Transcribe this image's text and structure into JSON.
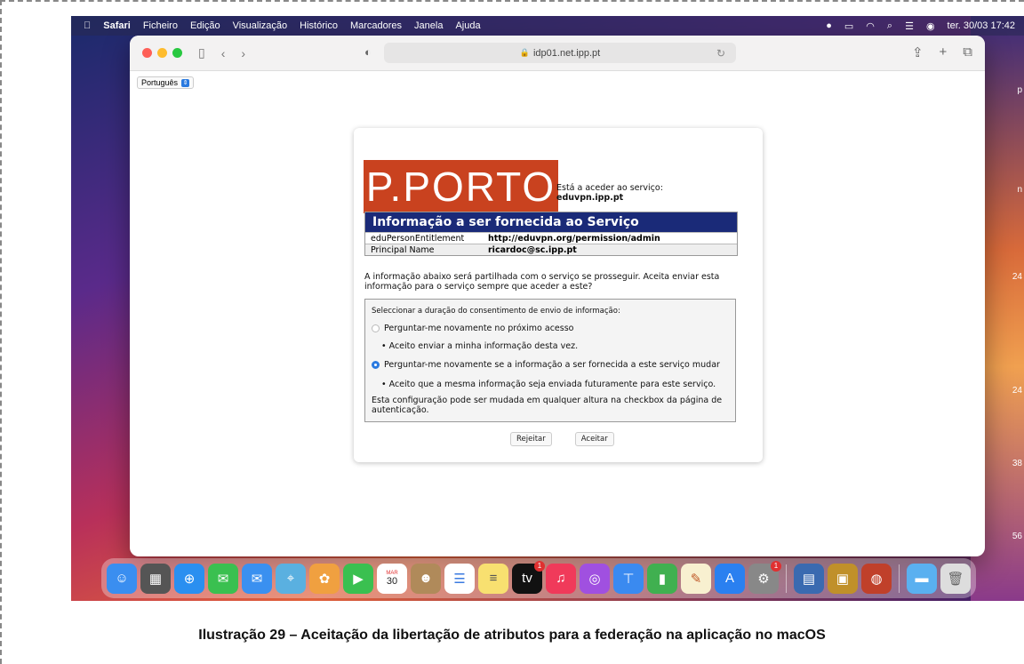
{
  "menubar": {
    "app": "Safari",
    "items": [
      "Ficheiro",
      "Edição",
      "Visualização",
      "Histórico",
      "Marcadores",
      "Janela",
      "Ajuda"
    ],
    "clock": "ter. 30/03 17:42"
  },
  "browser": {
    "url": "idp01.net.ipp.pt"
  },
  "language_selector": {
    "value": "Português"
  },
  "consent_card": {
    "logo": "P.PORTO",
    "service_prefix": "Está a aceder ao serviço:",
    "service_name": "eduvpn.ipp.pt",
    "info_title": "Informação a ser fornecida ao Serviço",
    "attributes": [
      {
        "name": "eduPersonEntitlement",
        "value": "http://eduvpn.org/permission/admin"
      },
      {
        "name": "Principal Name",
        "value": "ricardoc@sc.ipp.pt"
      }
    ],
    "notice": "A informação abaixo será partilhada com o serviço se prosseguir. Aceita enviar esta informação para o serviço sempre que aceder a este?",
    "duration_title": "Seleccionar a duração do consentimento de envio de informação:",
    "option_1": "Perguntar-me novamente no próximo acesso",
    "option_1_detail": "Aceito enviar a minha informação desta vez.",
    "option_2": "Perguntar-me novamente se a informação a ser fornecida a este serviço mudar",
    "option_2_detail": "Aceito que a mesma informação seja enviada futuramente para este serviço.",
    "footer_note": "Esta configuração pode ser mudada em qualquer altura na checkbox da página de autenticação.",
    "reject_label": "Rejeitar",
    "accept_label": "Aceitar"
  },
  "dock": {
    "calendar_month": "MAR",
    "calendar_day": "30",
    "tv_badge": "1",
    "settings_badge": "1"
  },
  "side_labels": [
    "p",
    "n",
    "24",
    "24",
    "38",
    "56"
  ],
  "caption": "Ilustração 29 – Aceitação da libertação de atributos para a federação na aplicação no macOS"
}
